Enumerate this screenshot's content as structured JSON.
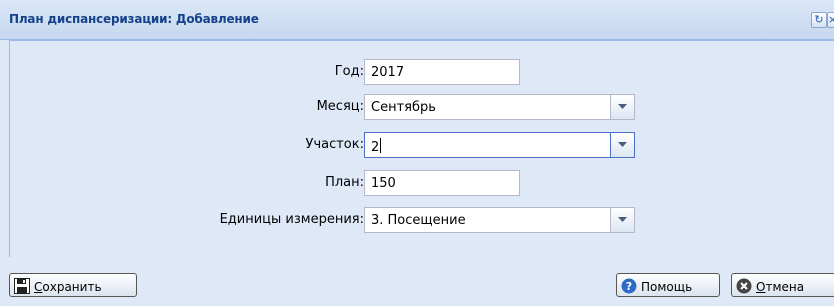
{
  "window": {
    "title": "План диспансеризации: Добавление"
  },
  "form": {
    "year_label": "Год:",
    "year_value": "2017",
    "month_label": "Месяц:",
    "month_value": "Сентябрь",
    "area_label": "Участок:",
    "area_value": "2",
    "plan_label": "План:",
    "plan_value": "150",
    "units_label": "Единицы измерения:",
    "units_value": "3. Посещение"
  },
  "footer": {
    "save_first": "С",
    "save_rest": "охранить",
    "help_label": "Помощь",
    "cancel_first": "О",
    "cancel_rest": "тмена"
  },
  "colors": {
    "title": "#15428b",
    "panel": "#dfe8f6",
    "focus_border": "#4d70c6"
  }
}
